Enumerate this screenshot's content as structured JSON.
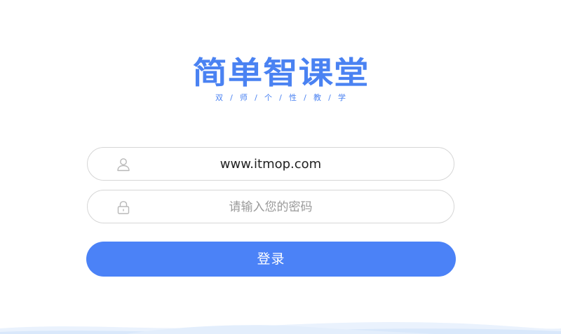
{
  "logo": {
    "title": "简单智课堂",
    "slogan_chars": [
      "双",
      "师",
      "个",
      "性",
      "教",
      "学"
    ],
    "separator": "/"
  },
  "username_field": {
    "icon": "user-icon",
    "value": "www.itmop.com"
  },
  "password_field": {
    "icon": "lock-icon",
    "placeholder": "请输入您的密码"
  },
  "login_button": {
    "label": "登录"
  },
  "colors": {
    "accent": "#4b82f7",
    "logo": "#4a82f2",
    "border": "#d6d6d6",
    "placeholder": "#9a9a9a",
    "icon": "#b8b8b8"
  }
}
